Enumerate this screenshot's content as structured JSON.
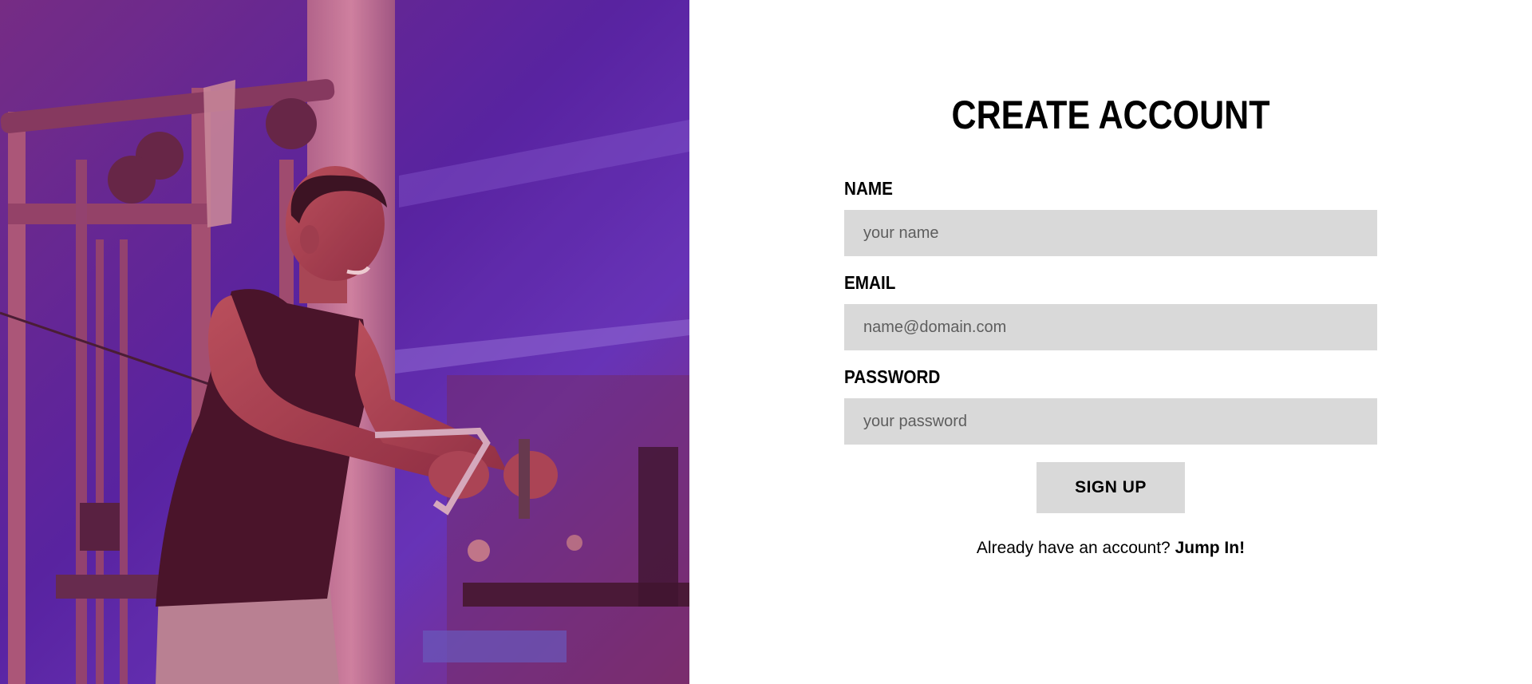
{
  "hero": {
    "image": "gym-man-cable-crossover-photo"
  },
  "form": {
    "title": "CREATE ACCOUNT",
    "fields": {
      "name": {
        "label": "NAME",
        "placeholder": "your name",
        "value": ""
      },
      "email": {
        "label": "EMAIL",
        "placeholder": "name@domain.com",
        "value": ""
      },
      "password": {
        "label": "PASSWORD",
        "placeholder": "your password",
        "value": ""
      }
    },
    "submit_label": "SIGN UP",
    "signin_prompt": "Already have an account?",
    "signin_link": "Jump In!"
  },
  "colors": {
    "field_bg": "#d9d9d9",
    "button_bg": "#d9d9d9",
    "text": "#000000",
    "hero_tint": "#5a2fbf"
  }
}
